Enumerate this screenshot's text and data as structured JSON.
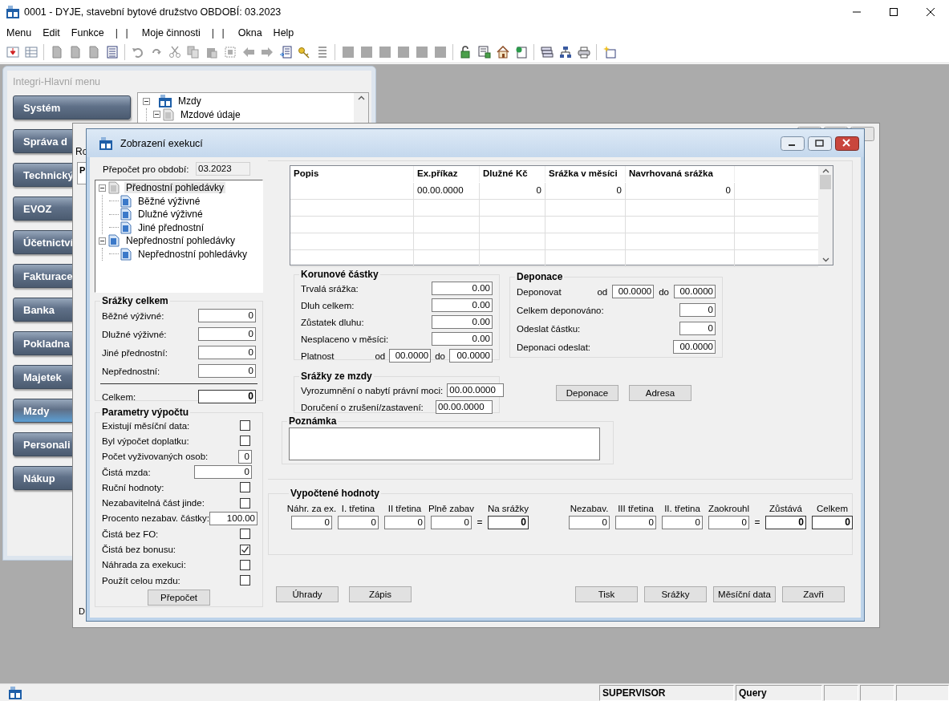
{
  "window": {
    "title": "0001 - DYJE, stavební bytové družstvo OBDOBÍ: 03.2023"
  },
  "menu": [
    {
      "label": "Menu",
      "kind": "item"
    },
    {
      "label": "Edit",
      "kind": "item"
    },
    {
      "label": "Funkce",
      "kind": "item"
    },
    {
      "label": "| |",
      "kind": "separator"
    },
    {
      "label": "Moje činnosti",
      "kind": "item"
    },
    {
      "label": "| |",
      "kind": "separator"
    },
    {
      "label": "Okna",
      "kind": "item"
    },
    {
      "label": "Help",
      "kind": "item"
    }
  ],
  "main_menu": {
    "title": "Integri-Hlavní menu",
    "buttons": [
      {
        "label": "Systém",
        "selected": false
      },
      {
        "label": "Správa d",
        "selected": false
      },
      {
        "label": "Technický",
        "selected": false
      },
      {
        "label": "EVOZ",
        "selected": false
      },
      {
        "label": "Účetnictví",
        "selected": false
      },
      {
        "label": "Fakturace",
        "selected": false
      },
      {
        "label": "Banka",
        "selected": false
      },
      {
        "label": "Pokladna",
        "selected": false
      },
      {
        "label": "Majetek",
        "selected": false
      },
      {
        "label": "Mzdy",
        "selected": true
      },
      {
        "label": "Personali",
        "selected": false
      },
      {
        "label": "Nákup",
        "selected": false
      }
    ],
    "tree": [
      {
        "label": "Mzdy",
        "expanded": true,
        "children": [
          {
            "label": "Mzdové údaje",
            "expanded": true
          }
        ]
      }
    ]
  },
  "background_window": {
    "texts": [
      "Ro",
      "P",
      "D"
    ]
  },
  "dialog": {
    "title": "Zobrazení exekucí",
    "period": {
      "label": "Přepočet pro období:",
      "value": "03.2023"
    },
    "tree": [
      {
        "label": "Přednostní pohledávky",
        "selected": true,
        "expanded": true,
        "children": [
          {
            "label": "Běžné výživné",
            "selected": false
          },
          {
            "label": "Dlužné výživné",
            "selected": false
          },
          {
            "label": "Jiné přednostní",
            "selected": false
          }
        ]
      },
      {
        "label": "Nepřednostní pohledávky",
        "selected": false,
        "expanded": true,
        "children": [
          {
            "label": "Nepřednostní pohledávky",
            "selected": false
          }
        ]
      }
    ],
    "totals": {
      "title": "Srážky celkem",
      "rows": [
        {
          "label": "Běžné výživné:",
          "value": "0"
        },
        {
          "label": "Dlužné výživné:",
          "value": "0"
        },
        {
          "label": "Jiné přednostní:",
          "value": "0"
        },
        {
          "label": "Nepřednostní:",
          "value": "0"
        }
      ],
      "total": {
        "label": "Celkem:",
        "value": "0"
      }
    },
    "parameters": {
      "title": "Parametry výpočtu",
      "rows": [
        {
          "kind": "checkbox",
          "label": "Existují měsíční data:",
          "checked": false
        },
        {
          "kind": "checkbox",
          "label": "Byl výpočet doplatku:",
          "checked": false
        },
        {
          "kind": "count",
          "label": "Počet vyživovaných osob:",
          "value": "0"
        },
        {
          "kind": "amount",
          "label": "Čistá mzda:",
          "value": "0"
        },
        {
          "kind": "checkbox",
          "label": "Ruční hodnoty:",
          "checked": false
        },
        {
          "kind": "checkbox",
          "label": "Nezabavitelná část jinde:",
          "checked": false
        },
        {
          "kind": "percent",
          "label": "Procento nezabav. částky:",
          "value": "100.00"
        },
        {
          "kind": "checkbox",
          "label": "Čistá bez FO:",
          "checked": false
        },
        {
          "kind": "checkbox",
          "label": "Čistá bez bonusu:",
          "checked": true
        },
        {
          "kind": "checkbox",
          "label": "Náhrada za exekuci:",
          "checked": false
        },
        {
          "kind": "checkbox",
          "label": "Použít celou mzdu:",
          "checked": false
        }
      ],
      "button": "Přepočet"
    },
    "table": {
      "columns": [
        "Popis",
        "Ex.příkaz",
        "Dlužné Kč",
        "Srážka v měsíci",
        "Navrhovaná srážka"
      ],
      "rows": [
        [
          null,
          "00.00.0000",
          "0",
          "0",
          "0"
        ]
      ]
    },
    "amounts": {
      "title": "Korunové částky",
      "rows": [
        {
          "label": "Trvalá srážka:",
          "value": "0.00"
        },
        {
          "label": "Dluh celkem:",
          "value": "0.00"
        },
        {
          "label": "Zůstatek dluhu:",
          "value": "0.00"
        },
        {
          "label": "Nesplaceno v měsíci:",
          "value": "0.00"
        }
      ],
      "validity": {
        "label": "Platnost",
        "from_label": "od",
        "from": "00.0000",
        "to_label": "do",
        "to": "00.0000"
      }
    },
    "deposit": {
      "title": "Deponace",
      "range": {
        "label": "Deponovat",
        "from_label": "od",
        "from": "00.0000",
        "to_label": "do",
        "to": "00.0000"
      },
      "rows": [
        {
          "label": "Celkem deponováno:",
          "value": "0"
        },
        {
          "label": "Odeslat částku:",
          "value": "0"
        },
        {
          "label": "Deponaci odeslat:",
          "value": "00.0000"
        }
      ]
    },
    "wage_deductions": {
      "title": "Srážky ze mzdy",
      "rows": [
        {
          "label": "Vyrozumnění o nabytí právní moci:",
          "value": "00.00.0000"
        },
        {
          "label": "Doručení o zrušení/zastavení:",
          "value": "00.00.0000"
        }
      ]
    },
    "deposit_buttons": [
      "Deponace",
      "Adresa"
    ],
    "note": {
      "title": "Poznámka"
    },
    "computed": {
      "title": "Vypočtené hodnoty",
      "groups": [
        {
          "fields": [
            {
              "label": "Náhr. za ex.",
              "value": "0"
            },
            {
              "label": "I. třetina",
              "value": "0"
            },
            {
              "label": "II třetina",
              "value": "0"
            },
            {
              "label": "Plně zabav",
              "value": "0"
            }
          ],
          "operator": "=",
          "result": {
            "label": "Na srážky",
            "value": "0"
          }
        },
        {
          "fields": [
            {
              "label": "Nezabav.",
              "value": "0"
            },
            {
              "label": "III třetina",
              "value": "0"
            },
            {
              "label": "II. třetina",
              "value": "0"
            },
            {
              "label": "Zaokrouhl",
              "value": "0"
            }
          ],
          "operator": "=",
          "result": {
            "label": "Zůstává",
            "value": "0"
          }
        }
      ],
      "total": {
        "label": "Celkem",
        "value": "0"
      }
    },
    "buttons_left": [
      "Úhrady",
      "Zápis"
    ],
    "buttons_right": [
      "Tisk",
      "Srážky",
      "Měsíční data",
      "Zavři"
    ]
  },
  "status_bar": {
    "cells": [
      "SUPERVISOR",
      "Query"
    ]
  }
}
